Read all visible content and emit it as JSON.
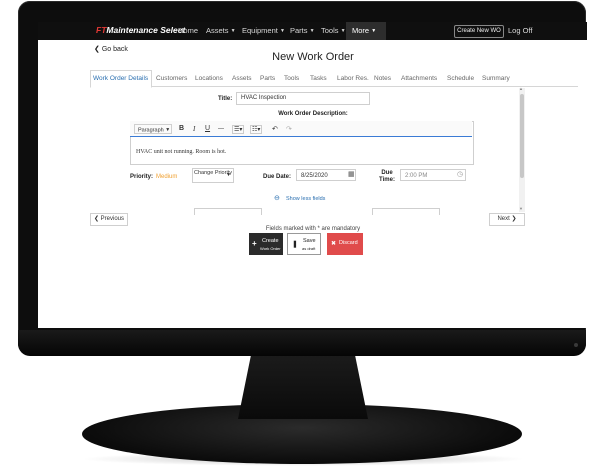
{
  "nav": {
    "logo_mark": "FT",
    "logo_text": "Maintenance Select",
    "items": [
      {
        "label": "Home"
      },
      {
        "label": "Assets"
      },
      {
        "label": "Equipment"
      },
      {
        "label": "Parts"
      },
      {
        "label": "Tools"
      },
      {
        "label": "More"
      }
    ],
    "create_new": "Create New WO",
    "logoff": "Log Off"
  },
  "header": {
    "go_back": "Go back",
    "title": "New Work Order"
  },
  "tabs": [
    {
      "label": "Work Order Details",
      "active": true
    },
    {
      "label": "Customers"
    },
    {
      "label": "Locations"
    },
    {
      "label": "Assets"
    },
    {
      "label": "Parts"
    },
    {
      "label": "Tools"
    },
    {
      "label": "Tasks"
    },
    {
      "label": "Labor Res."
    },
    {
      "label": "Notes"
    },
    {
      "label": "Attachments"
    },
    {
      "label": "Schedule"
    },
    {
      "label": "Summary"
    }
  ],
  "form": {
    "title_label": "Title:",
    "title_value": "HVAC Inspection",
    "description_label": "Work Order Description:",
    "toolbar": {
      "paragraph": "Paragraph",
      "bold": "B",
      "italic": "I",
      "underline": "U"
    },
    "description_text": "HVAC unit not running. Room is hot.",
    "priority_label": "Priority:",
    "priority_value": "Medium",
    "change_priority": "Change Priority",
    "due_date_label": "Due Date:",
    "due_date_value": "8/25/2020",
    "due_time_label": "Due Time:",
    "due_time_value": "2:00 PM",
    "show_less": "Show less fields"
  },
  "footer": {
    "previous": "Previous",
    "next": "Next",
    "mandatory_note": "Fields marked with * are mandatory",
    "create_label": "Create",
    "create_sub": "Work Order",
    "save_label": "Save",
    "save_sub": "as draft",
    "discard_label": "Discard"
  },
  "colors": {
    "accent": "#2a6fb0",
    "priority": "#f0a030",
    "danger": "#e04b4b",
    "nav_bg": "#0f0f0f"
  }
}
